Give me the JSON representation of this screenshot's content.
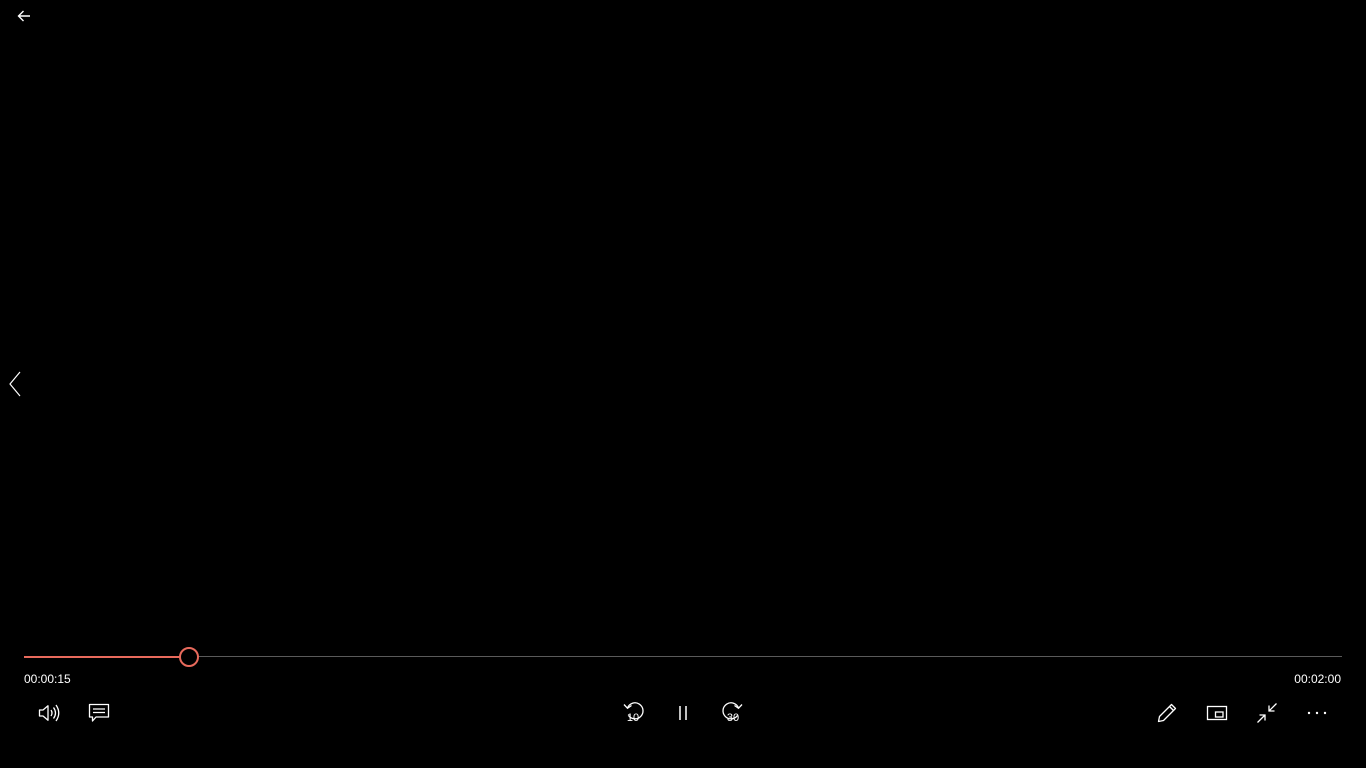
{
  "player": {
    "elapsed_time": "00:00:15",
    "total_time": "00:02:00",
    "progress_fraction": 0.125,
    "accent_color": "#e86a5c"
  },
  "icons": {
    "back": "back-arrow-icon",
    "previous": "chevron-left-icon",
    "volume": "speaker-icon",
    "captions": "captions-icon",
    "rewind": "rewind-10-icon",
    "pause": "pause-icon",
    "forward": "forward-30-icon",
    "edit": "pencil-icon",
    "miniview": "mini-view-icon",
    "exit_fullscreen": "exit-fullscreen-icon",
    "more": "more-icon"
  },
  "controls": {
    "rewind_seconds": "10",
    "forward_seconds": "30"
  }
}
